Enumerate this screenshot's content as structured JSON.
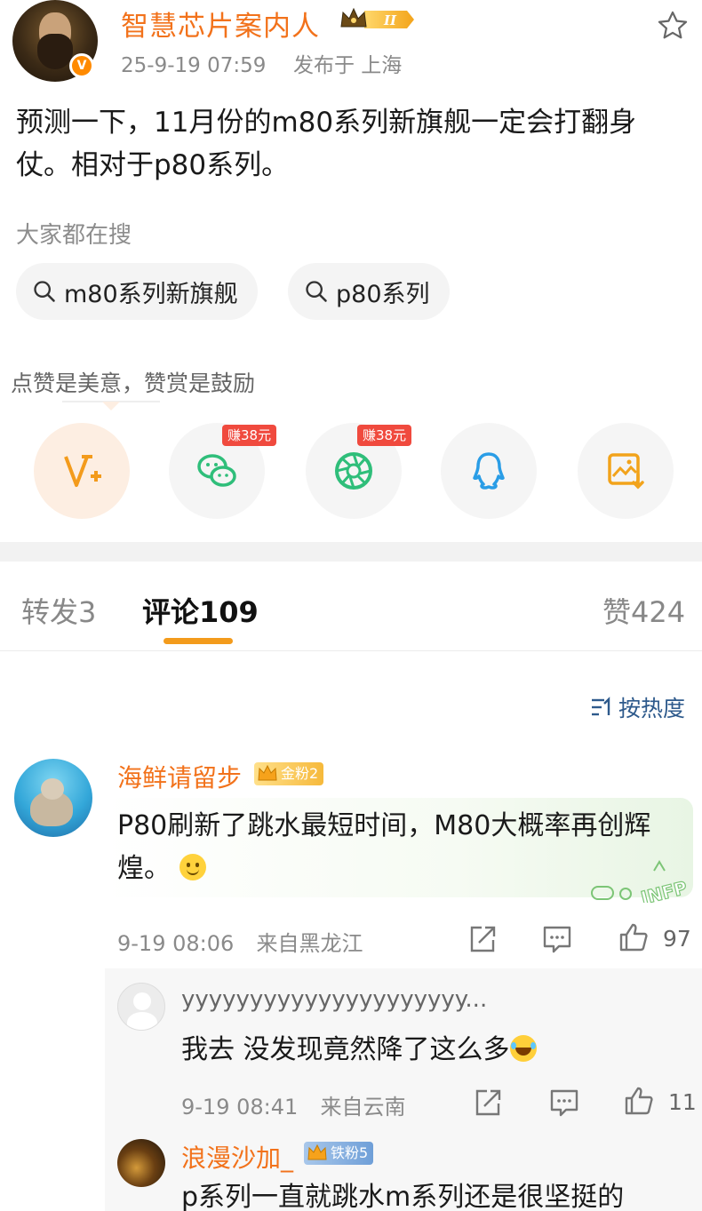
{
  "post": {
    "author": "智慧芯片案内人",
    "level_badge": "II",
    "date": "25-9-19 07:59",
    "location": "发布于 上海",
    "text": "预测一下，11月份的m80系列新旗舰一定会打翻身仗。相对于p80系列。",
    "verified_mark": "V"
  },
  "search": {
    "title": "大家都在搜",
    "chips": [
      "m80系列新旗舰",
      "p80系列"
    ]
  },
  "reward": {
    "text": "点赞是美意，赞赏是鼓励",
    "share_items": [
      {
        "icon": "v-plus-icon",
        "color": "#f39b1c"
      },
      {
        "icon": "wechat-icon",
        "color": "#2fbe7a",
        "tag": "赚38元"
      },
      {
        "icon": "moments-icon",
        "color": "#2fbe7a",
        "tag": "赚38元"
      },
      {
        "icon": "qq-icon",
        "color": "#2a9de6"
      },
      {
        "icon": "save-image-icon",
        "color": "#f2a31b"
      }
    ]
  },
  "tabs": {
    "repost": "转发",
    "repost_count": "3",
    "comments": "评论",
    "comments_count": "109",
    "likes": "赞",
    "likes_count": "424",
    "sort": "按热度"
  },
  "comments": [
    {
      "name": "海鲜请留步",
      "fan_badge": "金粉2",
      "text": "P80刷新了跳水最短时间，M80大概率再创辉煌。",
      "time": "9-19 08:06",
      "location": "来自黑龙江",
      "likes": "97",
      "sticker_text": "INFP",
      "replies": [
        {
          "name": "yyyyyyyyyyyyyyyyyyyyy...",
          "text": "我去 没发现竟然降了这么多",
          "time": "9-19 08:41",
          "location": "来自云南",
          "likes": "11"
        },
        {
          "name": "浪漫沙加_",
          "fan_badge": "铁粉5",
          "text": "p系列一直就跳水m系列还是很坚挺的"
        }
      ]
    }
  ],
  "colors": {
    "accent_orange": "#f2721b",
    "tab_underline": "#f39b1c",
    "sort_blue": "#2e5a8c",
    "earn_red": "#f04a3e"
  }
}
